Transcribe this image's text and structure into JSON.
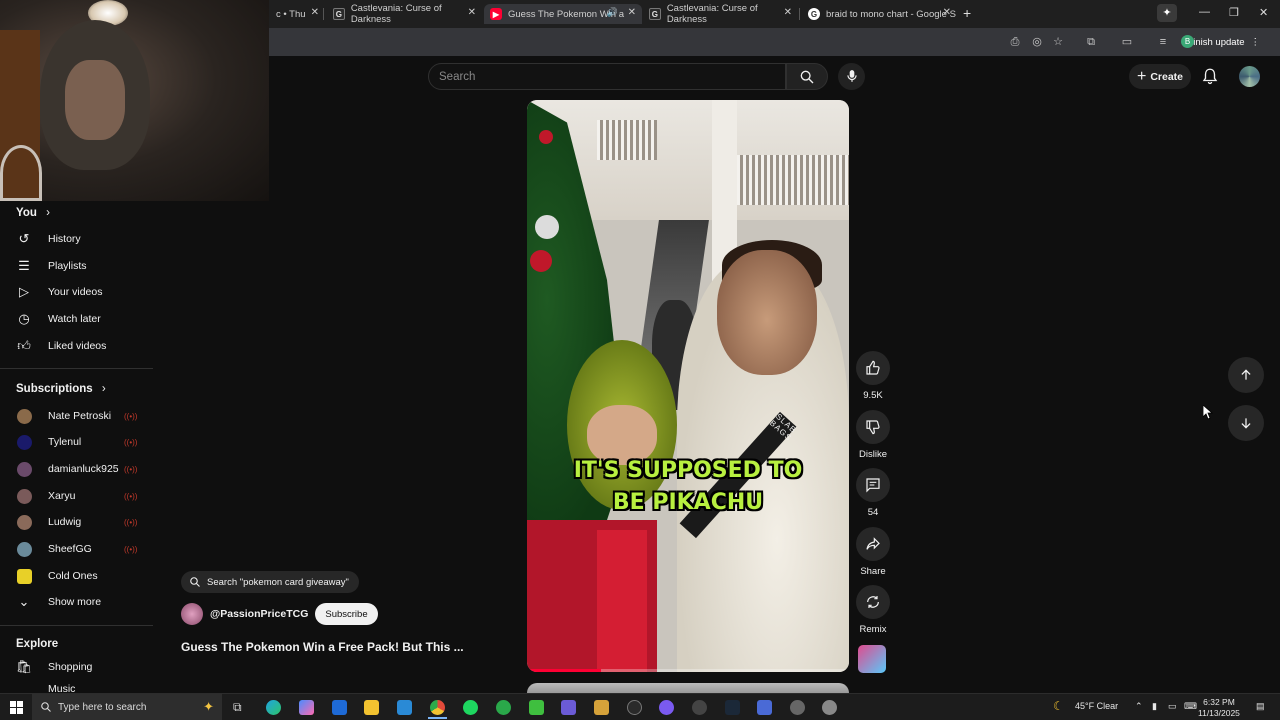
{
  "browser": {
    "tabs": [
      {
        "title": "c • Thu",
        "active": false
      },
      {
        "title": "Castlevania: Curse of Darkness",
        "active": false
      },
      {
        "title": "Guess The Pokemon Win a",
        "active": true
      },
      {
        "title": "Castlevania: Curse of Darkness",
        "active": false
      },
      {
        "title": "braid to mono chart - Google S",
        "active": false
      }
    ],
    "new_tab": "+",
    "finish_update": "Finish update",
    "profile_initial": "B"
  },
  "header": {
    "search_placeholder": "Search",
    "create_label": "Create"
  },
  "sidebar": {
    "you_label": "You",
    "you_items": [
      {
        "label": "History",
        "icon": "history-icon"
      },
      {
        "label": "Playlists",
        "icon": "playlists-icon"
      },
      {
        "label": "Your videos",
        "icon": "your-videos-icon"
      },
      {
        "label": "Watch later",
        "icon": "watch-later-icon"
      },
      {
        "label": "Liked videos",
        "icon": "liked-videos-icon"
      }
    ],
    "subscriptions_label": "Subscriptions",
    "subscriptions": [
      {
        "label": "Nate Petroski",
        "live": true,
        "color": "#8a6a4a"
      },
      {
        "label": "Tylenul",
        "live": true,
        "color": "#1a1a6a"
      },
      {
        "label": "damianluck925",
        "live": true,
        "color": "#6a4a6a"
      },
      {
        "label": "Xaryu",
        "live": true,
        "color": "#7a5a5a"
      },
      {
        "label": "Ludwig",
        "live": true,
        "color": "#8a6a5a"
      },
      {
        "label": "SheefGG",
        "live": true,
        "color": "#6a8a9a"
      },
      {
        "label": "Cold Ones",
        "live": false,
        "color": "#e8d028"
      }
    ],
    "show_more": "Show more",
    "explore_label": "Explore",
    "explore_items": [
      {
        "label": "Shopping",
        "icon": "shopping-icon"
      },
      {
        "label": "Music",
        "icon": "music-icon"
      }
    ]
  },
  "video": {
    "caption_line1": "IT'S SUPPOSED TO",
    "caption_line2": "BE PIKACHU",
    "progress_fraction": 0.23
  },
  "actions": {
    "likes": "9.5K",
    "dislike_label": "Dislike",
    "comments": "54",
    "share_label": "Share",
    "remix_label": "Remix"
  },
  "overlay": {
    "search_chip": "Search \"pokemon card giveaway\"",
    "channel": "@PassionPriceTCG",
    "subscribe_label": "Subscribe",
    "title": "Guess The Pokemon Win a Free Pack! But This ..."
  },
  "taskbar": {
    "search_placeholder": "Type here to search",
    "weather": "45°F  Clear",
    "time": "6:32 PM",
    "date": "11/13/2025"
  }
}
